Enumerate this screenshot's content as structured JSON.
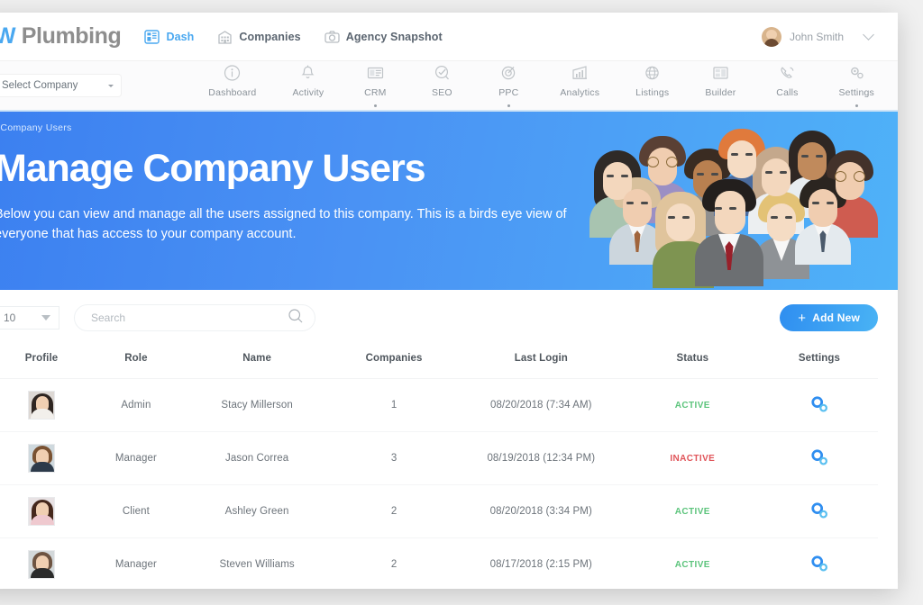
{
  "topbar": {
    "brand_accent": "W",
    "brand_text": " Plumbing",
    "links": [
      {
        "label": "Dash",
        "icon": "dashboard-grid-icon",
        "active": true
      },
      {
        "label": "Companies",
        "icon": "building-icon",
        "active": false
      },
      {
        "label": "Agency Snapshot",
        "icon": "camera-icon",
        "active": false
      }
    ],
    "user": {
      "name": "John Smith",
      "avatar": "user-avatar",
      "caret": "chevron-down-icon"
    }
  },
  "subnav": {
    "company_select": {
      "value": "Select Company",
      "caret": "caret-down-icon"
    },
    "items": [
      {
        "label": "Dashboard",
        "icon": "info-circle-icon",
        "dot": false
      },
      {
        "label": "Activity",
        "icon": "bell-icon",
        "dot": false
      },
      {
        "label": "CRM",
        "icon": "card-list-icon",
        "dot": true
      },
      {
        "label": "SEO",
        "icon": "target-check-icon",
        "dot": false
      },
      {
        "label": "PPC",
        "icon": "target-icon",
        "dot": true
      },
      {
        "label": "Analytics",
        "icon": "bar-chart-icon",
        "dot": false
      },
      {
        "label": "Listings",
        "icon": "globe-icon",
        "dot": false
      },
      {
        "label": "Builder",
        "icon": "layout-icon",
        "dot": false
      },
      {
        "label": "Calls",
        "icon": "phone-icon",
        "dot": false
      },
      {
        "label": "Settings",
        "icon": "gears-icon",
        "dot": true
      }
    ]
  },
  "hero": {
    "breadcrumb": "/ Company Users",
    "title": "Manage Company Users",
    "subtitle": "Below you can view and manage all the users assigned to this company. This is a birds eye view of everyone that has access to your company account.",
    "illustration": "group-of-people-illustration",
    "bg_start": "#3b7ff0",
    "bg_end": "#4fb2f8"
  },
  "toolbar": {
    "page_size": "10",
    "search_placeholder": "Search",
    "search_value": "",
    "search_icon": "search-icon",
    "add_label": "Add New",
    "add_icon": "plus-icon",
    "add_color": "#2f8ef0"
  },
  "table": {
    "columns": [
      "Profile",
      "Role",
      "Name",
      "Companies",
      "Last Login",
      "Status",
      "Settings"
    ],
    "rows": [
      {
        "profile": "avatar-stacy",
        "role": "Admin",
        "name": "Stacy Millerson",
        "companies": "1",
        "last_login": "08/20/2018 (7:34 AM)",
        "status": "ACTIVE",
        "settings": "gears-icon"
      },
      {
        "profile": "avatar-jason",
        "role": "Manager",
        "name": "Jason Correa",
        "companies": "3",
        "last_login": "08/19/2018 (12:34 PM)",
        "status": "INACTIVE",
        "settings": "gears-icon"
      },
      {
        "profile": "avatar-ashley",
        "role": "Client",
        "name": "Ashley Green",
        "companies": "2",
        "last_login": "08/20/2018 (3:34 PM)",
        "status": "ACTIVE",
        "settings": "gears-icon"
      },
      {
        "profile": "avatar-steven",
        "role": "Manager",
        "name": "Steven Williams",
        "companies": "2",
        "last_login": "08/17/2018 (2:15 PM)",
        "status": "ACTIVE",
        "settings": "gears-icon"
      }
    ],
    "status_colors": {
      "ACTIVE": "#5cc47c",
      "INACTIVE": "#e0555a"
    }
  }
}
